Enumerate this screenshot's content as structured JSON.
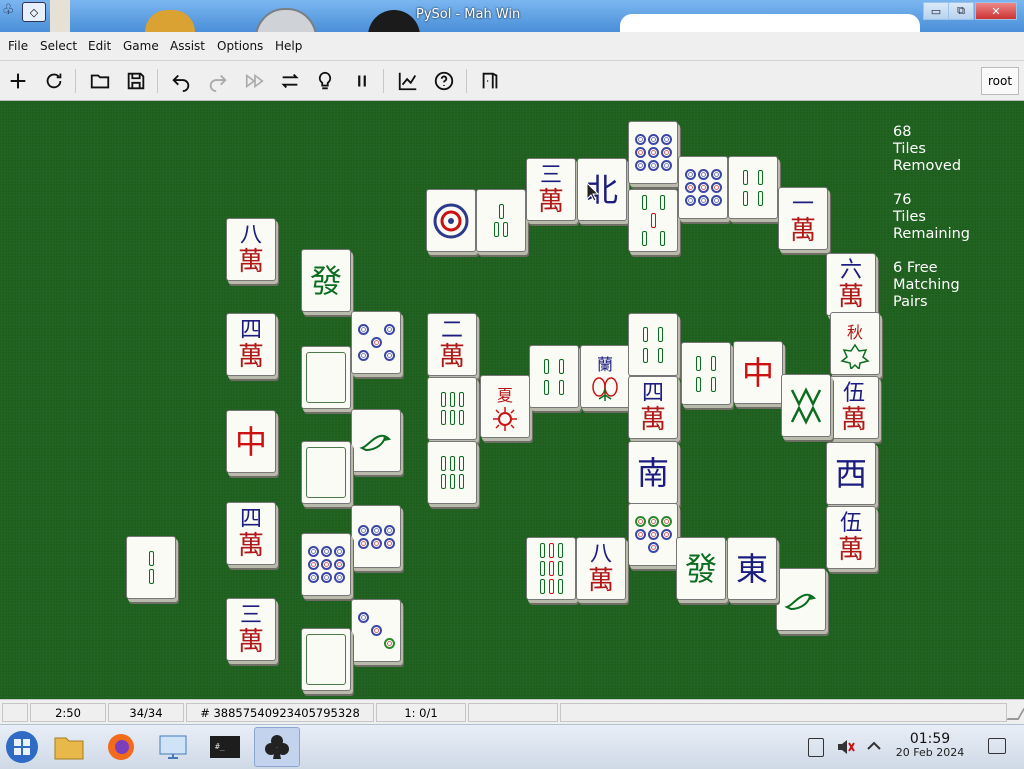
{
  "window": {
    "title": "PySol - Mah    Win",
    "minimize_glyph": "▭",
    "maximize_glyph": "⧉",
    "close_glyph": "✕"
  },
  "menu": [
    {
      "label": "File"
    },
    {
      "label": "Select"
    },
    {
      "label": "Edit"
    },
    {
      "label": "Game"
    },
    {
      "label": "Assist"
    },
    {
      "label": "Options"
    },
    {
      "label": "Help"
    }
  ],
  "toolbar": {
    "buttons": [
      "new-icon",
      "restart-icon",
      "open-icon",
      "save-icon",
      "undo-icon",
      "redo-icon",
      "autodrop-icon",
      "shuffle-icon",
      "hint-icon",
      "pause-icon",
      "statistics-icon",
      "rules-icon",
      "quit-icon"
    ],
    "user": "root"
  },
  "info": {
    "removed_count": "68",
    "removed_l1": "Tiles",
    "removed_l2": "Removed",
    "remaining_count": "76",
    "remaining_l1": "Tiles",
    "remaining_l2": "Remaining",
    "free_l1": "6 Free",
    "free_l2": "Matching",
    "free_l3": "Pairs"
  },
  "tiles": {
    "char8_a": "八",
    "char_wan": "萬",
    "char4": "四",
    "char3": "三",
    "char2": "二",
    "char1": "一",
    "char6": "六",
    "char5": "伍",
    "red_dragon": "中",
    "green_dragon": "發",
    "north": "北",
    "south": "南",
    "west": "西",
    "east": "東",
    "orchid": "蘭",
    "summer": "夏",
    "autumn": "秋"
  },
  "status": {
    "time": "2:50",
    "moves": "34/34",
    "game_number": "# 3885754092340579532​8",
    "score": "1: 0/1"
  },
  "taskbar": {
    "clock_time": "01:59",
    "clock_date": "20 Feb 2024"
  },
  "colors": {
    "felt": "#1e5f1e",
    "tile_face": "#fbfbf5",
    "char_red": "#b01818",
    "char_blue": "#1d1d80"
  }
}
